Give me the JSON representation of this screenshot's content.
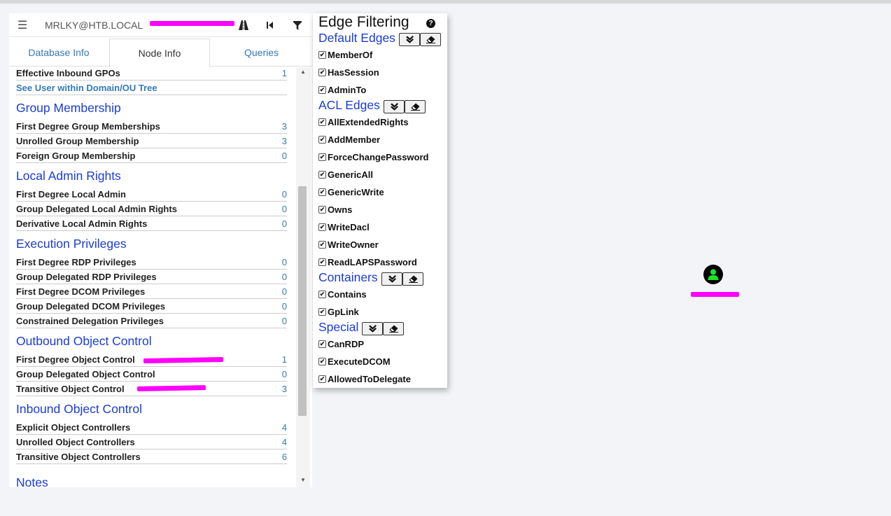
{
  "search": {
    "value": "MRLKY@HTB.LOCAL",
    "placeholder": ""
  },
  "icons": {
    "menu": "hamburger-icon",
    "path": "road-icon",
    "back": "skip-back-icon",
    "filter": "filter-icon",
    "help": "question-circle-icon",
    "node": "user-icon"
  },
  "tabs": [
    {
      "label": "Database Info"
    },
    {
      "label": "Node Info"
    },
    {
      "label": "Queries"
    }
  ],
  "node_info": {
    "top_rows": [
      {
        "label": "Effective Inbound GPOs",
        "value": "1"
      },
      {
        "label": "See User within Domain/OU Tree",
        "value": ""
      }
    ],
    "sections": [
      {
        "title": "Group Membership",
        "rows": [
          {
            "label": "First Degree Group Memberships",
            "value": "3"
          },
          {
            "label": "Unrolled Group Membership",
            "value": "3"
          },
          {
            "label": "Foreign Group Membership",
            "value": "0"
          }
        ]
      },
      {
        "title": "Local Admin Rights",
        "rows": [
          {
            "label": "First Degree Local Admin",
            "value": "0"
          },
          {
            "label": "Group Delegated Local Admin Rights",
            "value": "0"
          },
          {
            "label": "Derivative Local Admin Rights",
            "value": "0"
          }
        ]
      },
      {
        "title": "Execution Privileges",
        "rows": [
          {
            "label": "First Degree RDP Privileges",
            "value": "0"
          },
          {
            "label": "Group Delegated RDP Privileges",
            "value": "0"
          },
          {
            "label": "First Degree DCOM Privileges",
            "value": "0"
          },
          {
            "label": "Group Delegated DCOM Privileges",
            "value": "0"
          },
          {
            "label": "Constrained Delegation Privileges",
            "value": "0"
          }
        ]
      },
      {
        "title": "Outbound Object Control",
        "rows": [
          {
            "label": "First Degree Object Control",
            "value": "1"
          },
          {
            "label": "Group Delegated Object Control",
            "value": "0"
          },
          {
            "label": "Transitive Object Control",
            "value": "3"
          }
        ]
      },
      {
        "title": "Inbound Object Control",
        "rows": [
          {
            "label": "Explicit Object Controllers",
            "value": "4"
          },
          {
            "label": "Unrolled Object Controllers",
            "value": "4"
          },
          {
            "label": "Transitive Object Controllers",
            "value": "6"
          }
        ]
      },
      {
        "title": "Notes",
        "rows": []
      }
    ]
  },
  "edge_filtering": {
    "title": "Edge Filtering",
    "groups": [
      {
        "title": "Default Edges",
        "items": [
          "MemberOf",
          "HasSession",
          "AdminTo"
        ]
      },
      {
        "title": "ACL Edges",
        "items": [
          "AllExtendedRights",
          "AddMember",
          "ForceChangePassword",
          "GenericAll",
          "GenericWrite",
          "Owns",
          "WriteDacl",
          "WriteOwner",
          "ReadLAPSPassword"
        ]
      },
      {
        "title": "Containers",
        "items": [
          "Contains",
          "GpLink"
        ]
      },
      {
        "title": "Special",
        "items": [
          "CanRDP",
          "ExecuteDCOM",
          "AllowedToDelegate"
        ]
      }
    ]
  },
  "colors": {
    "accent": "#1a3cd6",
    "link": "#337ab7",
    "redaction": "#ff00ff",
    "node_user": "#17e625"
  }
}
